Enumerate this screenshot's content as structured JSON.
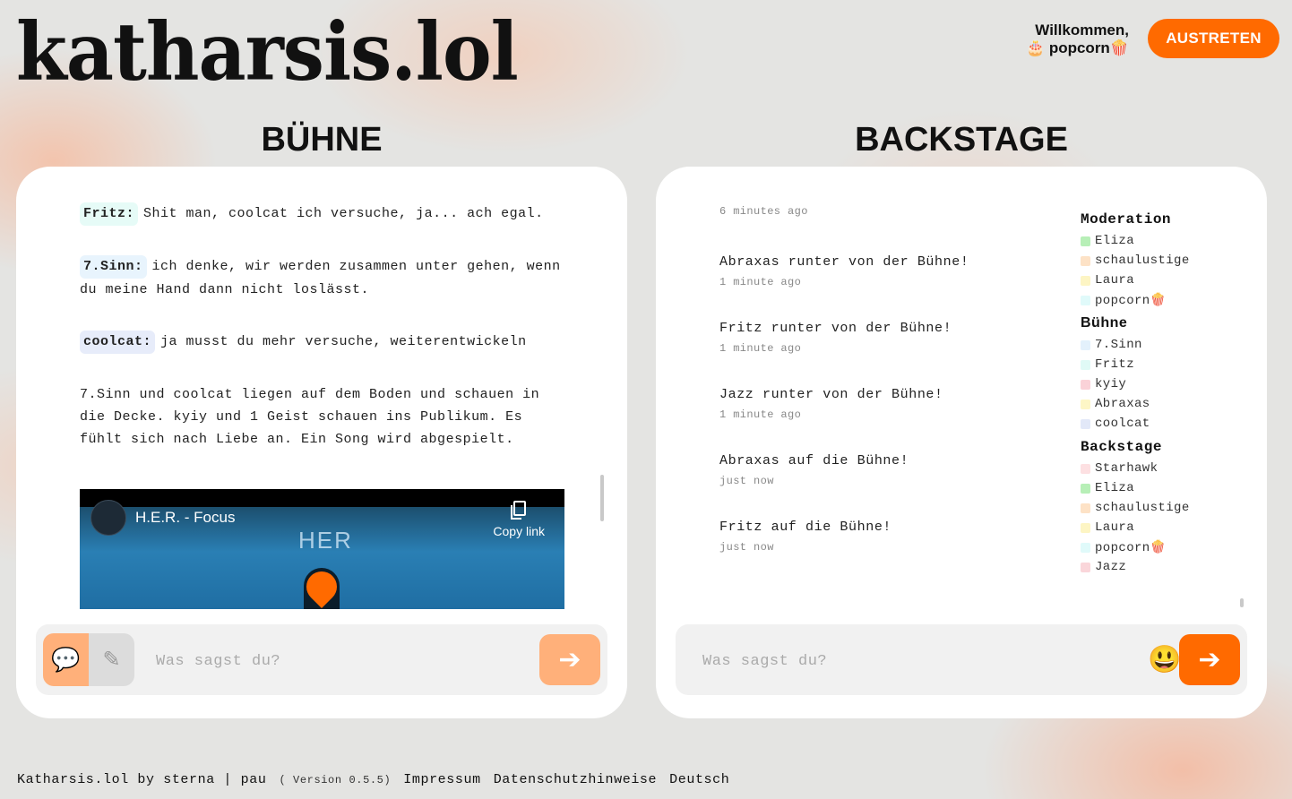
{
  "app": {
    "logo": "katharsis.lol"
  },
  "header": {
    "welcome_line1": "Willkommen,",
    "welcome_line2": "🎂 popcorn🍿",
    "leave_label": "AUSTRETEN"
  },
  "stage": {
    "title": "BÜHNE",
    "messages": [
      {
        "speaker": "Fritz:",
        "text": "Shit man, coolcat ich versuche, ja... ach egal.",
        "color": "#e6fbf7"
      },
      {
        "speaker": "7.Sinn:",
        "text": "ich denke, wir werden zusammen unter gehen, wenn du meine Hand dann nicht loslässt.",
        "color": "#e8f4fd"
      },
      {
        "speaker": "coolcat:",
        "text": "ja musst du mehr versuche, weiterentwickeln",
        "color": "#e7ecfa"
      }
    ],
    "narration": "7.Sinn und coolcat liegen auf dem Boden und schauen in die Decke. kyiy und 1 Geist schauen ins Publikum. Es fühlt sich nach Liebe an. Ein Song wird abgespielt.",
    "video": {
      "title": "H.E.R. - Focus",
      "copy_label": "Copy link",
      "brand": "HER"
    },
    "input": {
      "placeholder": "Was sagst du?",
      "say_icon": "speech-bubble-icon",
      "act_icon": "pencil-icon"
    },
    "send_color": "#ffb07a"
  },
  "backstage": {
    "title": "BACKSTAGE",
    "events": [
      {
        "text": "",
        "time": "6 minutes ago"
      },
      {
        "text": "Abraxas runter von der Bühne!",
        "time": "1 minute ago"
      },
      {
        "text": "Fritz runter von der Bühne!",
        "time": "1 minute ago"
      },
      {
        "text": "Jazz runter von der Bühne!",
        "time": "1 minute ago"
      },
      {
        "text": "Abraxas auf die Bühne!",
        "time": "just now"
      },
      {
        "text": "Fritz auf die Bühne!",
        "time": "just now"
      }
    ],
    "groups": [
      {
        "title": "Moderation",
        "users": [
          {
            "name": "Eliza",
            "color": "#b7efb7"
          },
          {
            "name": "schaulustige",
            "color": "#fde2c6"
          },
          {
            "name": "Laura",
            "color": "#fdf5c4"
          },
          {
            "name": "popcorn🍿",
            "color": "#e0fafa"
          }
        ]
      },
      {
        "title": "Bühne",
        "users": [
          {
            "name": "7.Sinn",
            "color": "#e3f1fc"
          },
          {
            "name": "Fritz",
            "color": "#e0faf6"
          },
          {
            "name": "kyiy",
            "color": "#fad2d8"
          },
          {
            "name": "Abraxas",
            "color": "#fdf6c6"
          },
          {
            "name": "coolcat",
            "color": "#e2e8f8"
          }
        ]
      },
      {
        "title": "Backstage",
        "users": [
          {
            "name": "Starhawk",
            "color": "#fde0e2"
          },
          {
            "name": "Eliza",
            "color": "#b7efb7"
          },
          {
            "name": "schaulustige",
            "color": "#fde2c6"
          },
          {
            "name": "Laura",
            "color": "#fdf5c4"
          },
          {
            "name": "popcorn🍿",
            "color": "#e0fafa"
          },
          {
            "name": "Jazz",
            "color": "#fad6da"
          }
        ]
      }
    ],
    "input": {
      "placeholder": "Was sagst du?",
      "emoji": "😃"
    },
    "send_color": "#ff6a00"
  },
  "footer": {
    "credit": "Katharsis.lol by sterna | pau",
    "version": "( Version 0.5.5)",
    "impressum": "Impressum",
    "privacy": "Datenschutzhinweise",
    "language": "Deutsch"
  },
  "colors": {
    "accent": "#ff6a00",
    "accent_light": "#ffb07a"
  }
}
